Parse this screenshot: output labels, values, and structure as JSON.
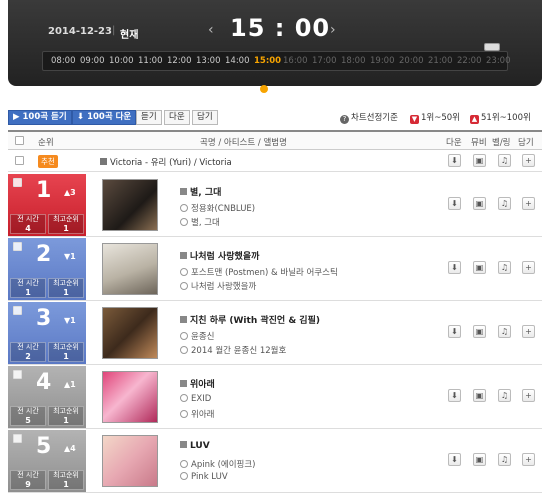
{
  "header": {
    "date": "2014-12-23",
    "separator": "|",
    "now_label": "현재",
    "prev_arrow": "‹",
    "next_arrow": "›",
    "big_time": "15 : 00",
    "hours": [
      "08:00",
      "09:00",
      "10:00",
      "11:00",
      "12:00",
      "13:00",
      "14:00",
      "15:00",
      "16:00",
      "17:00",
      "18:00",
      "19:00",
      "20:00",
      "21:00",
      "22:00",
      "23:00"
    ],
    "active_hour": "15:00"
  },
  "toolbar": {
    "listen_100": "▶ 100곡 듣기",
    "download_100": "⬇ 100곡 다운",
    "listen": "듣기",
    "download": "다운",
    "add": "담기",
    "chart_basis": "차트선정기준",
    "rank_1_50": "1위~50위",
    "rank_51_100": "51위~100위"
  },
  "table_header": {
    "rank": "순위",
    "info": "곡명 / 아티스트 / 앨범명",
    "download": "다운",
    "player": "뮤비",
    "ringtone": "벨/링",
    "add": "담기"
  },
  "recommend": {
    "badge": "추천",
    "text": "Victoria - 유리 (Yuri) / Victoria"
  },
  "rows": [
    {
      "rank": "1",
      "change": "▲3",
      "sub_left_label": "전 시간",
      "sub_left_val": "4",
      "sub_right_label": "최고순위",
      "sub_right_val": "1",
      "title": "별, 그대",
      "artist": "정용화(CNBLUE)",
      "album": "별, 그대",
      "color": "red"
    },
    {
      "rank": "2",
      "change": "▼1",
      "sub_left_label": "전 시간",
      "sub_left_val": "1",
      "sub_right_label": "최고순위",
      "sub_right_val": "1",
      "title": "나처럼 사랑했을까",
      "artist": "포스트맨 (Postmen) & 바닐라 어쿠스틱",
      "album": "나처럼 사랑했을까",
      "color": "blue"
    },
    {
      "rank": "3",
      "change": "▼1",
      "sub_left_label": "전 시간",
      "sub_left_val": "2",
      "sub_right_label": "최고순위",
      "sub_right_val": "1",
      "title": "지친 하루 (With 곽진언 & 김필)",
      "artist": "윤종신",
      "album": "2014 월간 윤종신 12월호",
      "color": "blue"
    },
    {
      "rank": "4",
      "change": "▲1",
      "sub_left_label": "전 시간",
      "sub_left_val": "5",
      "sub_right_label": "최고순위",
      "sub_right_val": "1",
      "title": "위아래",
      "artist": "EXID",
      "album": "위아래",
      "color": "gray"
    },
    {
      "rank": "5",
      "change": "▲4",
      "sub_left_label": "전 시간",
      "sub_left_val": "9",
      "sub_right_label": "최고순위",
      "sub_right_val": "1",
      "title": "LUV",
      "artist": "Apink (에이핑크)",
      "album": "Pink LUV",
      "color": "gray"
    }
  ],
  "action_icons": {
    "download": "⬇",
    "player": "▣",
    "ringtone": "♫",
    "add": "+"
  }
}
